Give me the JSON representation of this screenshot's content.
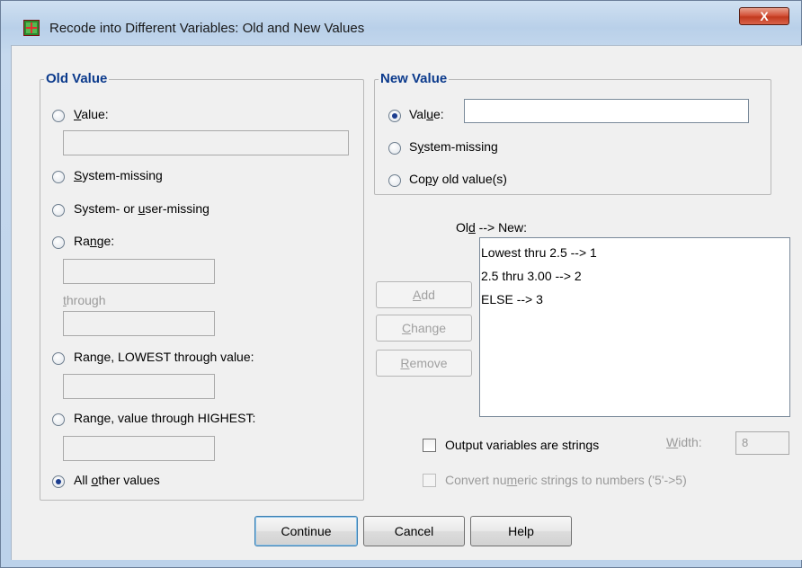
{
  "window": {
    "title": "Recode into Different Variables: Old and New Values",
    "close_label": "X"
  },
  "old_value": {
    "group_title": "Old Value",
    "options": {
      "value": {
        "pre": "",
        "u": "V",
        "post": "alue:",
        "checked": false
      },
      "system_missing": {
        "pre": "",
        "u": "S",
        "post": "ystem-missing",
        "checked": false
      },
      "system_or_user_missing": {
        "pre": "System- or ",
        "u": "u",
        "post": "ser-missing",
        "checked": false
      },
      "range": {
        "pre": "Ra",
        "u": "n",
        "post": "ge:",
        "checked": false
      },
      "range_lowest": {
        "pre": "Range, LOWEST through value:",
        "u": "",
        "post": "",
        "checked": false
      },
      "range_highest": {
        "pre": "Ran",
        "u": "g",
        "post": "e, value through HIGHEST:",
        "checked": false
      },
      "all_other": {
        "pre": "All ",
        "u": "o",
        "post": "ther values",
        "checked": true
      }
    },
    "through_label": {
      "pre": "",
      "u": "t",
      "post": "hrough"
    },
    "value_input": "",
    "range_from": "",
    "range_to": "",
    "range_lowest_value": "",
    "range_highest_value": ""
  },
  "new_value": {
    "group_title": "New Value",
    "options": {
      "value": {
        "pre": "Val",
        "u": "u",
        "post": "e:",
        "checked": true
      },
      "system_missing": {
        "pre": "S",
        "u": "y",
        "post": "stem-missing",
        "checked": false
      },
      "copy_old": {
        "pre": "Co",
        "u": "p",
        "post": "y old value(s)",
        "checked": false
      }
    },
    "value_input": ""
  },
  "mapping": {
    "label": {
      "pre": "Ol",
      "u": "d",
      "post": " --> New:"
    },
    "items": [
      "Lowest thru 2.5 --> 1",
      "2.5 thru 3.00 --> 2",
      "ELSE --> 3"
    ],
    "buttons": {
      "add": {
        "pre": "",
        "u": "A",
        "post": "dd"
      },
      "change": {
        "pre": "",
        "u": "C",
        "post": "hange"
      },
      "remove": {
        "pre": "",
        "u": "R",
        "post": "emove"
      }
    }
  },
  "options": {
    "output_strings": {
      "label": "Output variables are strings",
      "checked": false
    },
    "width_label": {
      "pre": "",
      "u": "W",
      "post": "idth:"
    },
    "width_value": "8",
    "convert_numeric": {
      "pre": "Convert nu",
      "u": "m",
      "post": "eric strings to numbers ('5'->5)",
      "checked": false
    }
  },
  "footer": {
    "continue": "Continue",
    "cancel": "Cancel",
    "help": "Help"
  }
}
